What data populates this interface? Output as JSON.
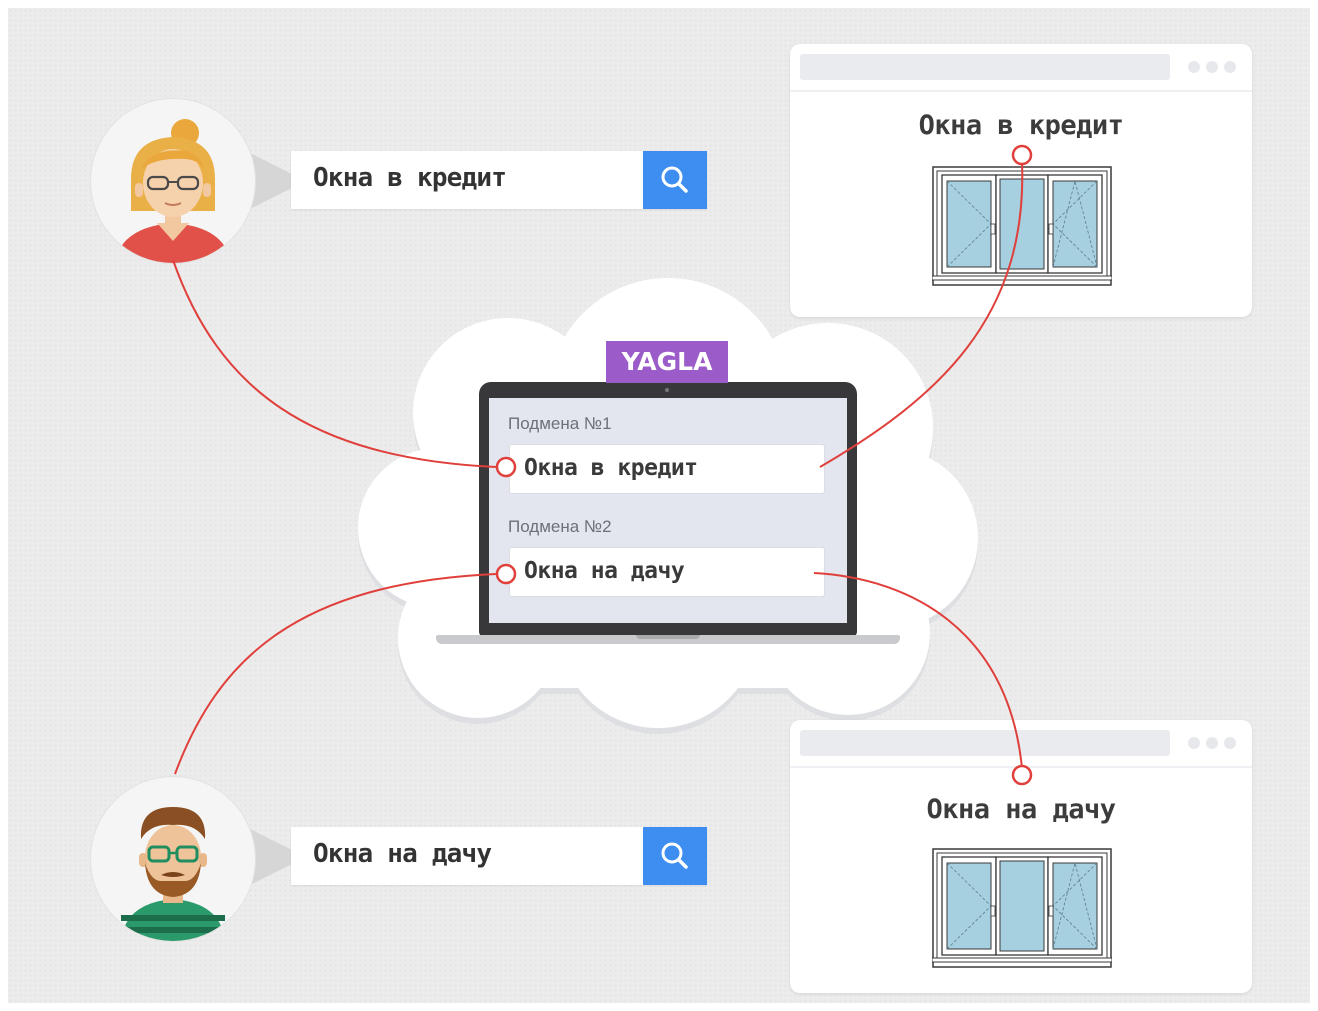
{
  "brand": {
    "label": "YAGLA",
    "color": "#9b5cc9"
  },
  "laptop": {
    "fields": [
      {
        "label": "Подмена №1",
        "value": "Окна в кредит"
      },
      {
        "label": "Подмена №2",
        "value": "Окна на дачу"
      }
    ]
  },
  "searches": [
    {
      "query": "Окна в кредит",
      "icon": "search-icon"
    },
    {
      "query": "Окна на дачу",
      "icon": "search-icon"
    }
  ],
  "pages": [
    {
      "title": "Окна в кредит",
      "image": "window-frame-icon"
    },
    {
      "title": "Окна на дачу",
      "image": "window-frame-icon"
    }
  ],
  "users": [
    {
      "avatar": "woman-avatar-icon"
    },
    {
      "avatar": "bearded-man-avatar-icon"
    }
  ],
  "colors": {
    "connector": "#e0403c",
    "search_button": "#3d8ef0",
    "screen": "#e3e5ef",
    "laptop_frame": "#38383a"
  }
}
